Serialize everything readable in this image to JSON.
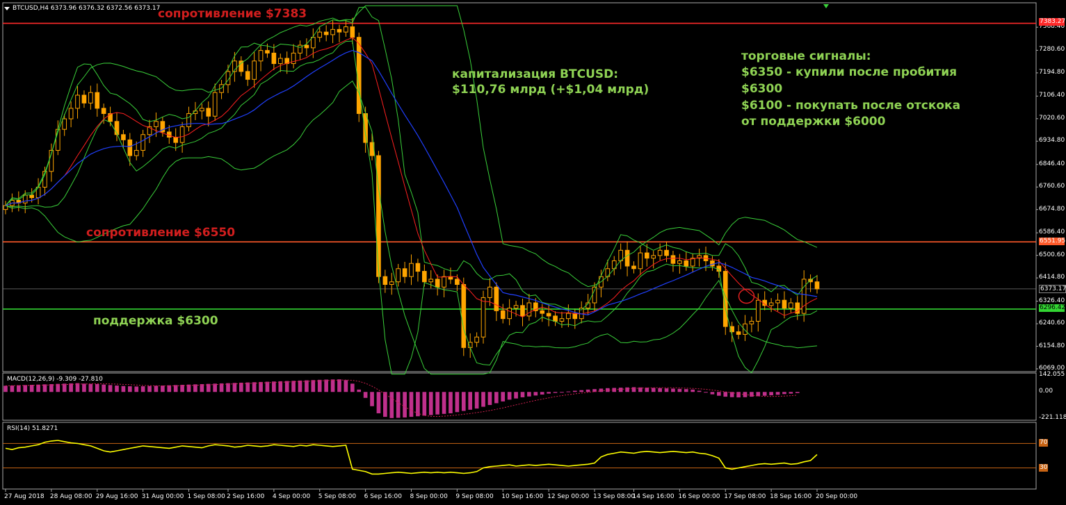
{
  "header": {
    "symbol_text": "BTCUSD,H4  6373.96 6376.32 6372.56 6373.17"
  },
  "annotations": {
    "resistance_top": "сопротивление $7383",
    "resistance_mid": "сопротивление $6550",
    "support": "поддержка $6300",
    "cap_line1": "капитализация BTCUSD:",
    "cap_line2": "$110,76 млрд (+$1,04 млрд)",
    "signals_title": "торговые сигналы:",
    "signal_1": "$6350 - купили после пробития",
    "signal_2": "$6300",
    "signal_3": "$6100 - покупать после отскока",
    "signal_4": "от поддержки $6000"
  },
  "indicators": {
    "macd_label": "MACD(12,26,9) -9.309 -27.810",
    "rsi_label": "RSI(14) 51.8271"
  },
  "price_axis": {
    "ticks": [
      "7368.40",
      "7280.60",
      "7194.80",
      "7106.40",
      "7020.60",
      "6934.80",
      "6846.40",
      "6760.60",
      "6674.80",
      "6586.40",
      "6500.60",
      "6414.80",
      "6326.40",
      "6240.60",
      "6154.80",
      "6069.00"
    ],
    "tag_resistance_top": "7383.27",
    "tag_resistance_mid": "6551.95",
    "tag_current": "6373.17",
    "tag_support": "6296.42"
  },
  "macd_axis": {
    "ticks": [
      "142.055",
      "0.00",
      "-221.118"
    ]
  },
  "rsi_axis": {
    "ticks": [
      "70",
      "30"
    ]
  },
  "time_axis": {
    "ticks": [
      "27 Aug 2018",
      "28 Aug 08:00",
      "29 Aug 16:00",
      "31 Aug 00:00",
      "1 Sep 08:00",
      "2 Sep 16:00",
      "4 Sep 00:00",
      "5 Sep 08:00",
      "6 Sep 16:00",
      "8 Sep 00:00",
      "9 Sep 08:00",
      "10 Sep 16:00",
      "12 Sep 00:00",
      "13 Sep 08:00",
      "14 Sep 16:00",
      "16 Sep 00:00",
      "17 Sep 08:00",
      "18 Sep 16:00",
      "20 Sep 00:00"
    ]
  },
  "colors": {
    "background": "#000000",
    "bull_candle": "#000000",
    "candle": "#ffa500",
    "resistance_line": "#ff2a2a",
    "resistance_mid_line": "#ff5a2a",
    "support_line": "#33d633",
    "ma_red": "#ff2020",
    "ma_blue": "#2040ff",
    "bollinger": "#3ad13a",
    "macd_hist": "#c0308c",
    "rsi_line": "#ffff00",
    "level_line": "#c86414"
  },
  "chart_data": {
    "type": "candlestick",
    "symbol": "BTCUSD",
    "timeframe": "H4",
    "ylim": [
      6069.0,
      7390.0
    ],
    "levels": [
      {
        "label": "сопротивление $7383",
        "value": 7383.27
      },
      {
        "label": "сопротивление $6550",
        "value": 6551.95
      },
      {
        "label": "поддержка $6300",
        "value": 6296.42
      },
      {
        "value": 6373.17
      }
    ],
    "close": [
      6690,
      6710,
      6700,
      6730,
      6720,
      6760,
      6820,
      6900,
      6980,
      7020,
      7060,
      7110,
      7080,
      7120,
      7060,
      7040,
      7010,
      6960,
      6940,
      6880,
      6900,
      6960,
      6990,
      7010,
      6970,
      6950,
      6930,
      6990,
      7040,
      7050,
      7060,
      7030,
      7120,
      7150,
      7200,
      7240,
      7200,
      7170,
      7240,
      7280,
      7270,
      7230,
      7250,
      7230,
      7270,
      7300,
      7290,
      7330,
      7350,
      7340,
      7360,
      7350,
      7370,
      7330,
      7040,
      6930,
      6880,
      6420,
      6390,
      6400,
      6450,
      6420,
      6470,
      6440,
      6400,
      6410,
      6380,
      6420,
      6410,
      6390,
      6150,
      6170,
      6190,
      6340,
      6380,
      6290,
      6260,
      6300,
      6310,
      6270,
      6320,
      6290,
      6280,
      6270,
      6250,
      6260,
      6280,
      6260,
      6300,
      6320,
      6380,
      6420,
      6450,
      6480,
      6520,
      6460,
      6450,
      6510,
      6490,
      6500,
      6520,
      6500,
      6470,
      6480,
      6460,
      6490,
      6500,
      6480,
      6460,
      6440,
      6230,
      6210,
      6200,
      6240,
      6250,
      6330,
      6310,
      6320,
      6330,
      6300,
      6320,
      6280,
      6410,
      6400,
      6373.17
    ],
    "macd": {
      "values": [
        52,
        54,
        56,
        58,
        60,
        62,
        64,
        66,
        68,
        70,
        72,
        74,
        70,
        68,
        66,
        62,
        58,
        54,
        50,
        48,
        46,
        48,
        50,
        52,
        54,
        56,
        58,
        60,
        62,
        64,
        66,
        68,
        70,
        72,
        74,
        76,
        78,
        80,
        82,
        84,
        86,
        88,
        90,
        92,
        94,
        96,
        98,
        100,
        102,
        104,
        105,
        106,
        100,
        70,
        20,
        -50,
        -120,
        -180,
        -210,
        -220,
        -218,
        -215,
        -210,
        -205,
        -200,
        -195,
        -190,
        -185,
        -180,
        -170,
        -160,
        -150,
        -140,
        -125,
        -110,
        -95,
        -80,
        -65,
        -55,
        -45,
        -38,
        -30,
        -22,
        -14,
        -8,
        -2,
        4,
        10,
        15,
        20,
        24,
        28,
        32,
        34,
        36,
        38,
        40,
        38,
        36,
        34,
        32,
        30,
        28,
        26,
        24,
        20,
        10,
        -5,
        -20,
        -32,
        -40,
        -44,
        -46,
        -44,
        -40,
        -36,
        -32,
        -28,
        -24,
        -18,
        -14,
        -9.3
      ],
      "signal": -27.81
    },
    "rsi": {
      "values": [
        62,
        60,
        63,
        64,
        66,
        68,
        72,
        74,
        75,
        73,
        71,
        70,
        68,
        66,
        62,
        58,
        56,
        58,
        60,
        62,
        64,
        66,
        65,
        64,
        63,
        62,
        64,
        66,
        65,
        64,
        63,
        66,
        68,
        67,
        66,
        64,
        65,
        67,
        66,
        65,
        66,
        68,
        67,
        66,
        65,
        67,
        66,
        68,
        67,
        66,
        65,
        66,
        67,
        28,
        26,
        24,
        20,
        20,
        21,
        22,
        23,
        22,
        21,
        22,
        23,
        22,
        23,
        22,
        23,
        22,
        21,
        22,
        24,
        30,
        32,
        33,
        34,
        35,
        33,
        34,
        35,
        34,
        35,
        36,
        35,
        34,
        33,
        34,
        35,
        36,
        38,
        48,
        52,
        54,
        56,
        55,
        54,
        56,
        57,
        56,
        55,
        56,
        57,
        56,
        55,
        56,
        54,
        53,
        50,
        46,
        30,
        28,
        30,
        32,
        34,
        36,
        37,
        36,
        37,
        38,
        36,
        37,
        40,
        42,
        51.83
      ],
      "levels": [
        70,
        30
      ]
    }
  }
}
